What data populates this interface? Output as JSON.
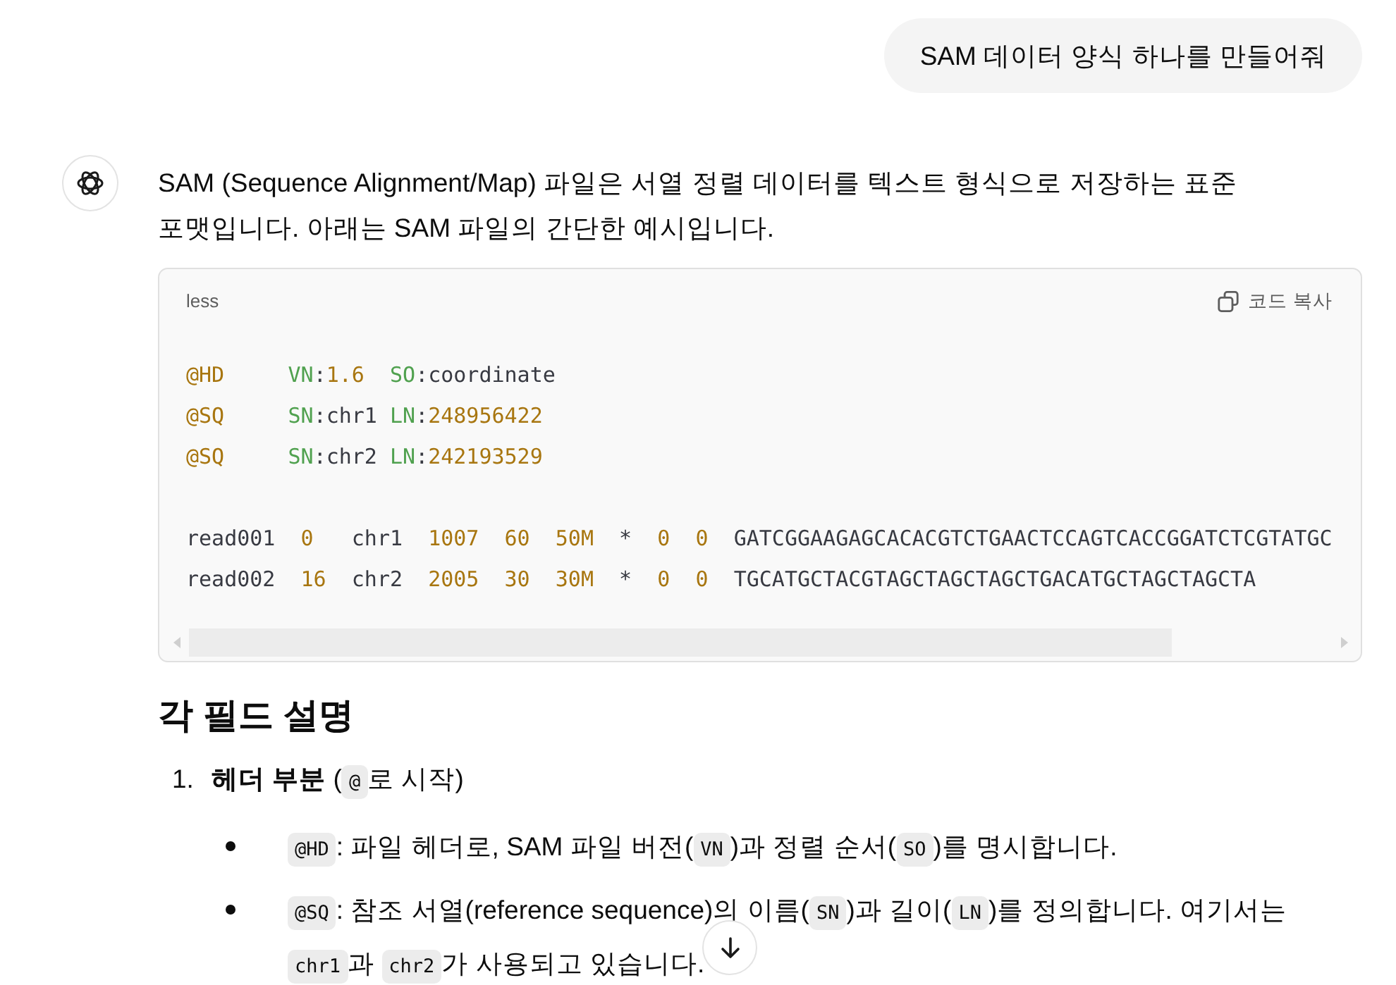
{
  "user_message": {
    "text": "SAM 데이터 양식 하나를 만들어줘"
  },
  "assistant_message": {
    "intro": "SAM (Sequence Alignment/Map) 파일은 서열 정렬 데이터를 텍스트 형식으로 저장하는 표준 포맷입니다. 아래는 SAM 파일의 간단한 예시입니다.",
    "code_block": {
      "language": "less",
      "copy_label": "코드 복사",
      "sections": [
        {
          "lines": [
            [
              {
                "kind": "tag",
                "text": "@HD"
              },
              {
                "kind": "key",
                "text": "     VN"
              },
              {
                "kind": "plain",
                "text": ":"
              },
              {
                "kind": "number",
                "text": "1.6"
              },
              {
                "kind": "key",
                "text": "  SO"
              },
              {
                "kind": "plain",
                "text": ":coordinate"
              }
            ],
            [
              {
                "kind": "tag",
                "text": "@SQ"
              },
              {
                "kind": "key",
                "text": "     SN"
              },
              {
                "kind": "plain",
                "text": ":chr1 "
              },
              {
                "kind": "key",
                "text": "LN"
              },
              {
                "kind": "plain",
                "text": ":"
              },
              {
                "kind": "number",
                "text": "248956422"
              }
            ],
            [
              {
                "kind": "tag",
                "text": "@SQ"
              },
              {
                "kind": "key",
                "text": "     SN"
              },
              {
                "kind": "plain",
                "text": ":chr2 "
              },
              {
                "kind": "key",
                "text": "LN"
              },
              {
                "kind": "plain",
                "text": ":"
              },
              {
                "kind": "number",
                "text": "242193529"
              }
            ]
          ]
        },
        {
          "lines": [
            [
              {
                "kind": "plain",
                "text": "read001  "
              },
              {
                "kind": "number",
                "text": "0"
              },
              {
                "kind": "plain",
                "text": "   chr1  "
              },
              {
                "kind": "number",
                "text": "1007  60  50M"
              },
              {
                "kind": "plain",
                "text": "  *  "
              },
              {
                "kind": "number",
                "text": "0  0"
              },
              {
                "kind": "plain",
                "text": "  GATCGGAAGAGCACACGTCTGAACTCCAGTCACCGGATCTCGTATGC"
              }
            ],
            [
              {
                "kind": "plain",
                "text": "read002  "
              },
              {
                "kind": "number",
                "text": "16"
              },
              {
                "kind": "plain",
                "text": "  chr2  "
              },
              {
                "kind": "number",
                "text": "2005  30  30M"
              },
              {
                "kind": "plain",
                "text": "  *  "
              },
              {
                "kind": "number",
                "text": "0  0"
              },
              {
                "kind": "plain",
                "text": "  TGCATGCTACGTAGCTAGCTAGCTGACATGCTAGCTAGCTA"
              }
            ]
          ]
        }
      ]
    },
    "heading": "각 필드 설명",
    "list": [
      {
        "number": "1.",
        "segments": [
          {
            "kind": "text",
            "text": "**헤더 부분** ("
          },
          {
            "kind": "code",
            "text": "@"
          },
          {
            "kind": "text",
            "text": "로 시작)"
          }
        ],
        "bullets": [
          {
            "segments": [
              {
                "kind": "code",
                "text": "@HD"
              },
              {
                "kind": "text",
                "text": ": 파일 헤더로, SAM 파일 버전("
              },
              {
                "kind": "code",
                "text": "VN"
              },
              {
                "kind": "text",
                "text": ")과 정렬 순서("
              },
              {
                "kind": "code",
                "text": "SO"
              },
              {
                "kind": "text",
                "text": ")를 명시합니다."
              }
            ]
          },
          {
            "segments": [
              {
                "kind": "code",
                "text": "@SQ"
              },
              {
                "kind": "text",
                "text": ": 참조 서열(reference sequence)의 이름("
              },
              {
                "kind": "code",
                "text": "SN"
              },
              {
                "kind": "text",
                "text": ")과 길이("
              },
              {
                "kind": "code",
                "text": "LN"
              },
              {
                "kind": "text",
                "text": ")를 정의합니다. 여기서는 "
              },
              {
                "kind": "code",
                "text": "chr1"
              },
              {
                "kind": "text",
                "text": "과 "
              },
              {
                "kind": "code",
                "text": "chr2"
              },
              {
                "kind": "text",
                "text": "가 사용되고 있습니다."
              }
            ]
          }
        ]
      }
    ]
  }
}
